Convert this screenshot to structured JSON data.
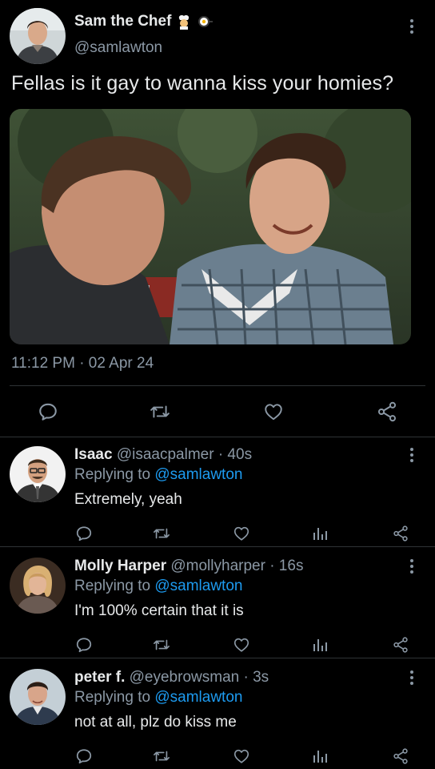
{
  "tweet": {
    "name": "Sam the Chef",
    "emojis": [
      "cook-emoji",
      "frying-pan-emoji"
    ],
    "handle": "@samlawton",
    "text": "Fellas is it gay to wanna kiss your homies?",
    "timestamp": "11:12 PM · 02 Apr 24",
    "actions": [
      "reply-icon",
      "retweet-icon",
      "like-icon",
      "share-icon"
    ]
  },
  "replies": [
    {
      "name": "Isaac",
      "handle": "@isaacpalmer",
      "time": "· 40s",
      "replying_label": "Replying to",
      "replying_to": "@samlawton",
      "text": "Extremely, yeah"
    },
    {
      "name": "Molly Harper",
      "handle": "@mollyharper",
      "time": "· 16s",
      "replying_label": "Replying to",
      "replying_to": "@samlawton",
      "text": "I'm 100% certain that it is"
    },
    {
      "name": "peter f.",
      "handle": "@eyebrowsman",
      "time": "· 3s",
      "replying_label": "Replying to",
      "replying_to": "@samlawton",
      "text": "not at all, plz do kiss me"
    }
  ],
  "colors": {
    "background": "#000000",
    "text": "#e7e9ea",
    "secondary": "#8b98a5",
    "mention": "#1d9bf0",
    "divider": "#2f3336"
  }
}
